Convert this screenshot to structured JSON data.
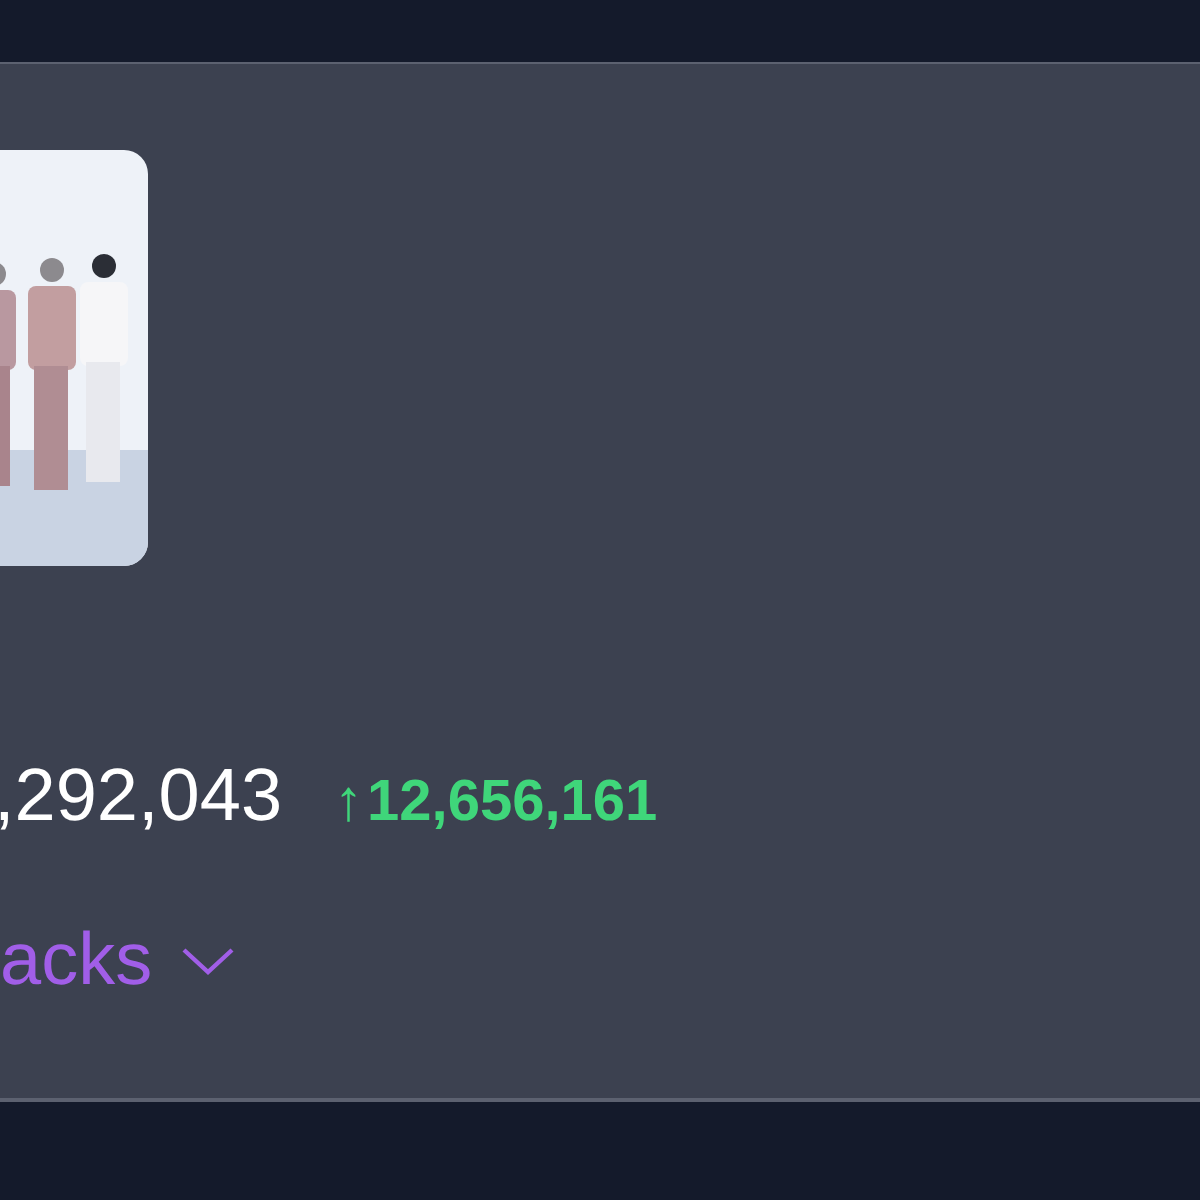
{
  "stats": {
    "total": ",292,043",
    "change_arrow": "↑",
    "change": "12,656,161"
  },
  "tracks_toggle": {
    "label": "acks",
    "expanded": false
  }
}
